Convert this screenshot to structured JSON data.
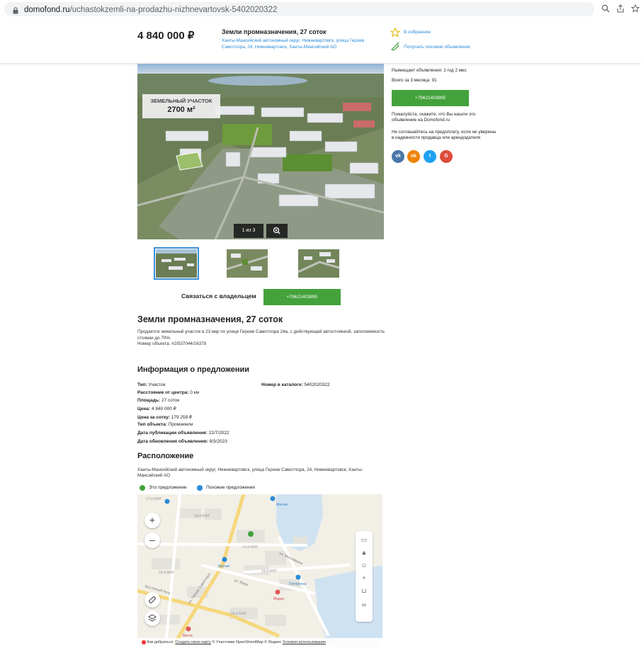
{
  "browser": {
    "url_host": "domofond.ru",
    "url_path": "/uchastokzemli-na-prodazhu-nizhnevartovsk-5402020322"
  },
  "header": {
    "price": "4 840 000 ₽",
    "title": "Земли промназначения, 27 соток",
    "address": "Ханты-Мансийский автономный округ, Нижневартовск, улица Героев Самотлора, 24, Нижневартовск, Ханты-Мансийский АО",
    "favorite_label": "В избранное",
    "similar_label": "Получать похожие объявления"
  },
  "photo": {
    "badge_line1": "ЗЕМЕЛЬНЫЙ УЧАСТОК",
    "badge_line2": "2700 м²",
    "counter": "1 из 3"
  },
  "contact": {
    "label": "Связаться с владельцем",
    "phone": "+79621403895"
  },
  "sidebar": {
    "posting_since": "Размещает объявления: 1 год 2 мес",
    "total_3_months": "Всего за 3 месяца: 91",
    "phone": "+79621403895",
    "note1": "Пожалуйста, скажите, что Вы нашли это объявление на Domofond.ru",
    "note2": "Не соглашайтесь на предоплату, если не уверены в надежности продавца или арендодателя",
    "social": [
      {
        "name": "vk",
        "label": "vk",
        "color": "#4a76a8"
      },
      {
        "name": "ok",
        "label": "ok",
        "color": "#ee8208"
      },
      {
        "name": "twitter",
        "label": "t",
        "color": "#1da1f2"
      },
      {
        "name": "google",
        "label": "G",
        "color": "#dd4b39"
      }
    ]
  },
  "listing": {
    "title": "Земли промназначения, 27 соток",
    "description": "Продается земельный участок в 23 мкр по улице Героев Самотлора 24а, с действующей автостоянкой, заполняемость стоянки до 70%.",
    "object_number": "Номер объекта: #2/537044/16378"
  },
  "info": {
    "heading": "Информация о предложении",
    "rows": [
      {
        "label": "Тип:",
        "value": "Участок"
      },
      {
        "label": "Расстояние от центра:",
        "value": "0 км"
      },
      {
        "label": "Площадь:",
        "value": "27 соток"
      },
      {
        "label": "Цена:",
        "value": "4 840 000 ₽"
      },
      {
        "label": "Цена за сотку:",
        "value": "179 259 ₽"
      },
      {
        "label": "Тип объекта:",
        "value": "Промземли"
      },
      {
        "label": "Дата публикации объявления:",
        "value": "22/7/2022"
      },
      {
        "label": "Дата обновления объявления:",
        "value": "9/3/2023"
      }
    ],
    "catalog_label": "Номер в каталоге:",
    "catalog_value": "5402020322"
  },
  "location": {
    "heading": "Расположение",
    "address": "Ханты-Мансийский автономный округ, Нижневартовск, улица Героев Самотлора, 24, Нижневартовск, Ханты-Мансийский АО",
    "legend_this": "Это предложение",
    "legend_similar": "Похожие предложения",
    "legend_this_color": "#44a23c",
    "legend_similar_color": "#2a8bd8"
  },
  "map": {
    "labels": {
      "mkr17": "17-й МКР.",
      "mkr18": "18-й МКР.",
      "mkr21": "21-й МКР.",
      "mkr22": "22-й МКР.",
      "mkr24": "24-й МКР.",
      "mkr25": "25-й МКР.",
      "street_moskovkina": "ул. Московкина",
      "street_mira": "ул. Мира",
      "street_vostochny": "Восточный пр-д",
      "street_samotlora": "ул. Героев Самотлора"
    },
    "poi": {
      "magnit1": "Магнит",
      "magnit2": "Магнит",
      "pyaterochka": "Пятёрочка",
      "medsi": "Медси",
      "vesta": "Веста"
    },
    "footer_route": "Как добраться",
    "footer_create": "Создать свою карту",
    "footer_osm": "© Участники OpenStreetMap © Яндекс",
    "footer_terms": "Условия использования"
  }
}
